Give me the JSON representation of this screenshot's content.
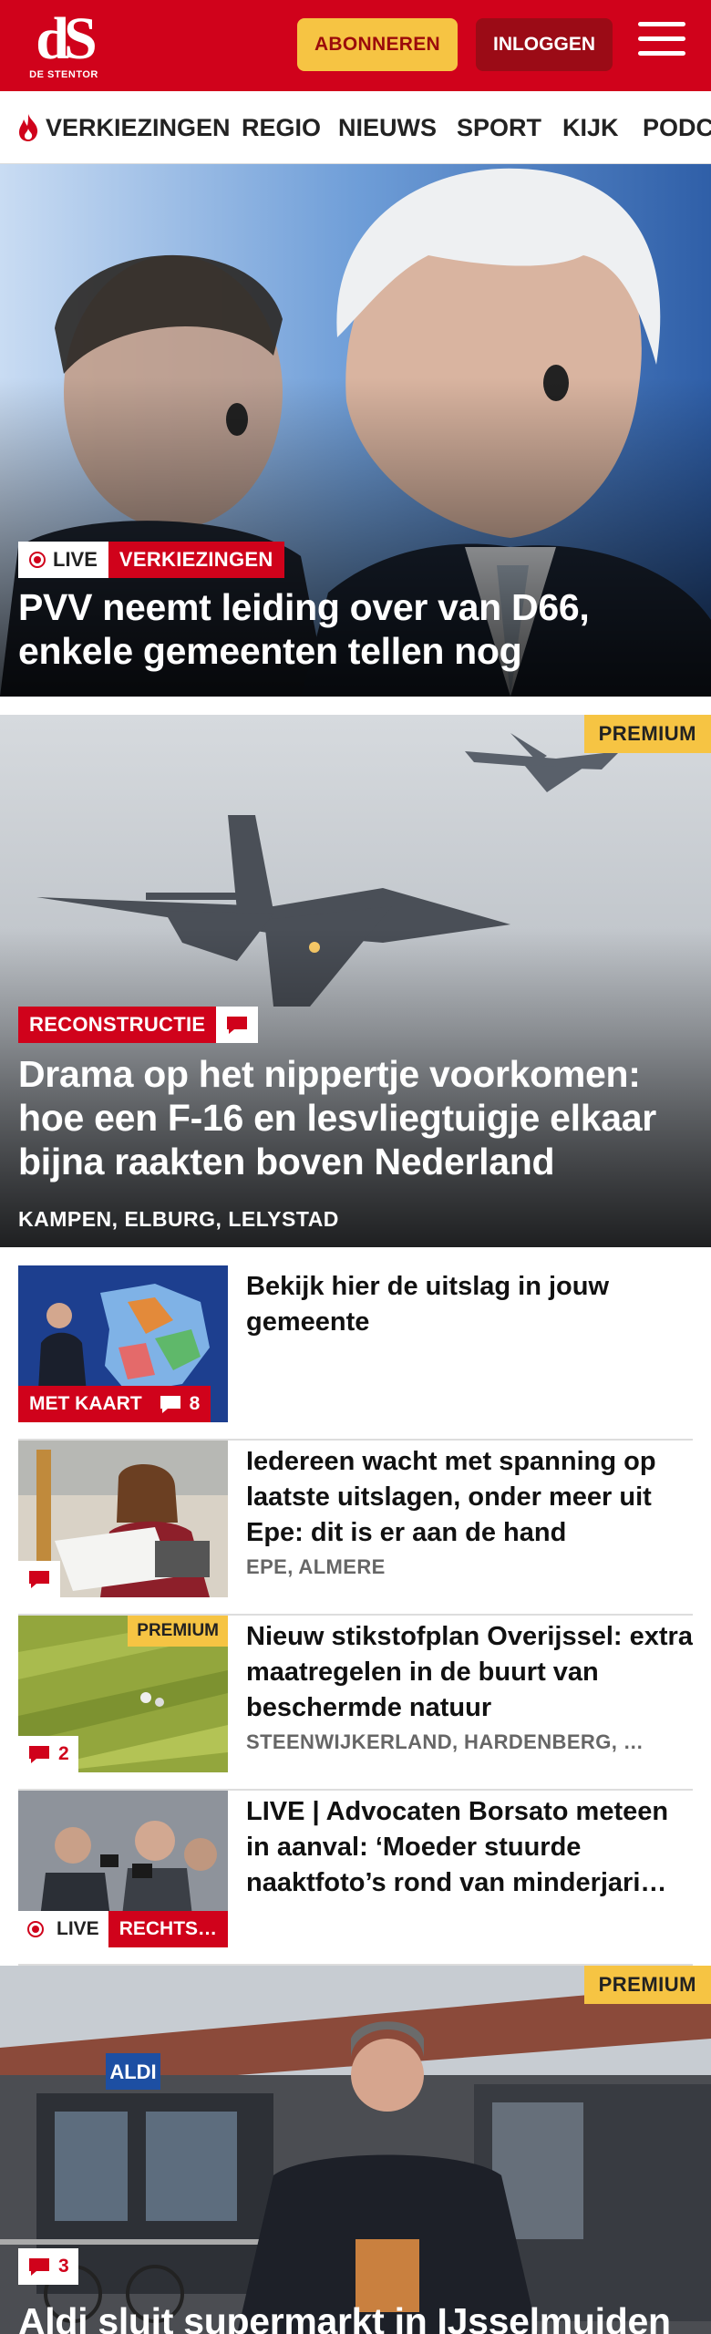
{
  "header": {
    "logo_mark": "dS",
    "logo_name": "DE STENTOR",
    "subscribe_label": "ABONNEREN",
    "login_label": "INLOGGEN"
  },
  "nav": {
    "items": [
      {
        "label": "VERKIEZINGEN"
      },
      {
        "label": "REGIO"
      },
      {
        "label": "NIEUWS"
      },
      {
        "label": "SPORT"
      },
      {
        "label": "KIJK"
      },
      {
        "label": "PODCASTS"
      }
    ]
  },
  "hero": {
    "live_label": "LIVE",
    "tag": "VERKIEZINGEN",
    "title": "PVV neemt leiding over van D66, enkele gemeenten tellen nog"
  },
  "feature": {
    "premium_label": "PREMIUM",
    "tag": "RECONSTRUCTIE",
    "title": "Drama op het nippertje voorkomen: hoe een F-16 en lesvliegtuigje elkaar bijna raakten boven Nederland",
    "places": "KAMPEN, ELBURG, LELYSTAD"
  },
  "list": [
    {
      "title": "Bekijk hier de uitslag in jouw gemeente",
      "tag": "MET KAART",
      "comments": "8",
      "places": ""
    },
    {
      "title": "Iedereen wacht met spanning op laatste uitslagen, onder meer uit Epe: dit is er aan de hand",
      "comments": "",
      "places": "EPE, ALMERE"
    },
    {
      "title": "Nieuw stikstofplan Overijssel: extra maatregelen in de buurt van beschermde natuur",
      "premium_label": "PREMIUM",
      "comments": "2",
      "places": "STEENWIJKERLAND, HARDENBERG, …"
    },
    {
      "title": "LIVE | Advocaten Borsato meteen in aanval: ‘Moeder stuurde naaktfoto’s rond van minderjari…",
      "live_label": "LIVE",
      "tag": "RECHTS…",
      "places": ""
    }
  ],
  "bottom": {
    "premium_label": "PREMIUM",
    "comments": "3",
    "store_sign": "ALDI",
    "title": "Aldi sluit supermarkt in IJsselmuiden"
  },
  "colors": {
    "brand_red": "#d0021b",
    "premium_yellow": "#f6c443",
    "login_dark_red": "#9b0b16"
  }
}
